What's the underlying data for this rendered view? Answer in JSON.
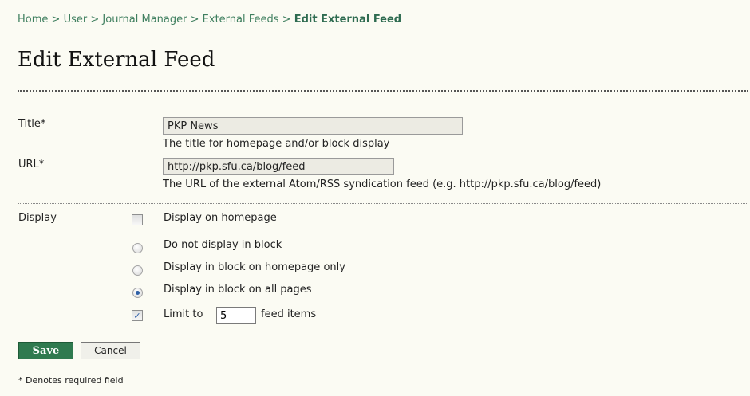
{
  "breadcrumb": {
    "items": [
      "Home",
      "User",
      "Journal Manager",
      "External Feeds"
    ],
    "separator": ">",
    "current": "Edit External Feed"
  },
  "page_title": "Edit External Feed",
  "form": {
    "title": {
      "label": "Title*",
      "value": "PKP News",
      "description": "The title for homepage and/or block display"
    },
    "url": {
      "label": "URL*",
      "value": "http://pkp.sfu.ca/blog/feed",
      "description": "The URL of the external Atom/RSS syndication feed (e.g. http://pkp.sfu.ca/blog/feed)"
    },
    "display": {
      "label": "Display",
      "homepage_checkbox": {
        "label": "Display on homepage",
        "checked": false
      },
      "radio_options": [
        {
          "label": "Do not display in block",
          "selected": false
        },
        {
          "label": "Display in block on homepage only",
          "selected": false
        },
        {
          "label": "Display in block on all pages",
          "selected": true
        }
      ],
      "limit": {
        "checked": true,
        "prefix": "Limit to",
        "value": "5",
        "suffix": "feed items"
      }
    }
  },
  "buttons": {
    "save": "Save",
    "cancel": "Cancel"
  },
  "footnote": "* Denotes required field",
  "colors": {
    "accent_green": "#2f7a4f",
    "link_green": "#3f7f5f",
    "background": "#fbfbf3"
  }
}
